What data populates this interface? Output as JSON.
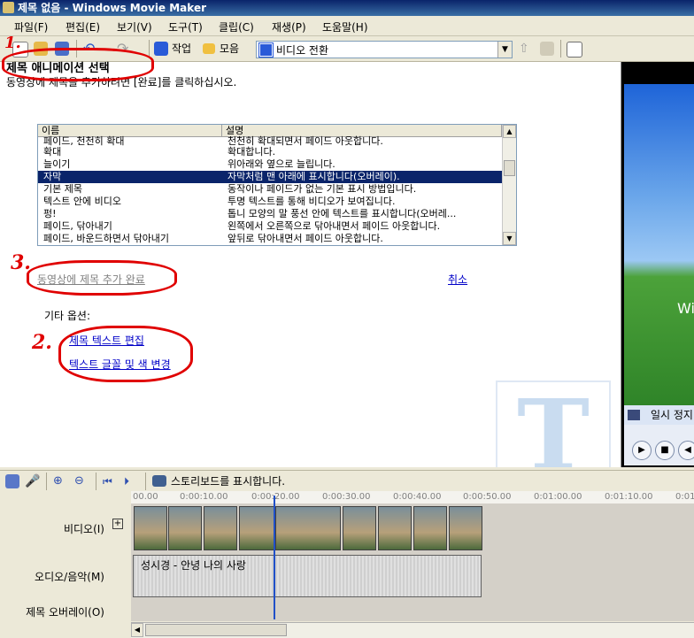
{
  "window": {
    "title": "제목 없음 - Windows Movie Maker"
  },
  "menu": [
    "파일(F)",
    "편집(E)",
    "보기(V)",
    "도구(T)",
    "클립(C)",
    "재생(P)",
    "도움말(H)"
  ],
  "toolbar": {
    "tasks_label": "작업",
    "collections_label": "모음",
    "collection_select": "비디오 전환"
  },
  "pane": {
    "title": "제목 애니메이션 선택",
    "subtitle": "동영상에 제목을 추가하려면 [완료]를 클릭하십시오.",
    "list": {
      "headers": [
        "이름",
        "설명"
      ],
      "rows": [
        {
          "name": "페이드, 천천히 확대",
          "desc": "천천히 확대되면서 페이드 아웃합니다."
        },
        {
          "name": "확대",
          "desc": "확대합니다."
        },
        {
          "name": "늘이기",
          "desc": "위아래와 옆으로 늘립니다."
        },
        {
          "name": "자막",
          "desc": "자막처럼 맨 아래에 표시합니다(오버레이).",
          "selected": true
        },
        {
          "name": "기본 제목",
          "desc": "동작이나 페이드가 없는 기본 표시 방법입니다."
        },
        {
          "name": "텍스트 안에 비디오",
          "desc": "투명 텍스트를 통해 비디오가 보여집니다."
        },
        {
          "name": "펑!",
          "desc": "톱니 모양의 말 풍선 안에 텍스트를 표시합니다(오버레..."
        },
        {
          "name": "페이드, 닦아내기",
          "desc": "왼쪽에서 오른쪽으로 닦아내면서 페이드 아웃합니다."
        },
        {
          "name": "페이드, 바운드하면서 닦아내기",
          "desc": "앞뒤로 닦아내면서 페이드 아웃합니다."
        }
      ]
    },
    "done_link": "동영상에 제목 추가 완료",
    "cancel_link": "취소",
    "other_options_label": "기타 옵션:",
    "edit_text_link": "제목 텍스트 편집",
    "font_color_link": "텍스트 글꼴 및 색 변경",
    "annotations": [
      "1.",
      "2.",
      "3."
    ]
  },
  "preview": {
    "status": "일시 정지"
  },
  "timeline": {
    "storyboard_label": "스토리보드를 표시합니다.",
    "ticks": [
      "00.00",
      "0:00:10.00",
      "0:00:20.00",
      "0:00:30.00",
      "0:00:40.00",
      "0:00:50.00",
      "0:01:00.00",
      "0:01:10.00",
      "0:01"
    ],
    "tracks": {
      "video": "비디오(I)",
      "audio": "오디오/음악(M)",
      "overlay": "제목 오버레이(O)"
    },
    "audio_clip": "성시경 - 안녕 나의 사랑"
  },
  "colors": {
    "annotation": "#e00000",
    "selection": "#0a246a",
    "link": "#0000c8"
  }
}
